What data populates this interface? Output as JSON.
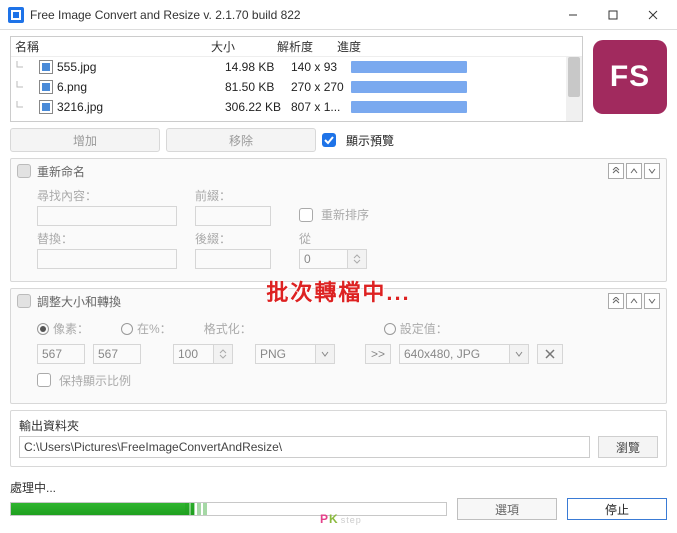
{
  "window": {
    "title": "Free Image Convert and Resize  v. 2.1.70 build 822"
  },
  "logo_text": "FS",
  "table": {
    "headers": {
      "name": "名稱",
      "size": "大小",
      "resolution": "解析度",
      "progress": "進度"
    },
    "rows": [
      {
        "name": "555.jpg",
        "size": "14.98 KB",
        "resolution": "140 x 93"
      },
      {
        "name": "6.png",
        "size": "81.50 KB",
        "resolution": "270 x 270"
      },
      {
        "name": "3216.jpg",
        "size": "306.22 KB",
        "resolution": "807 x 1..."
      }
    ]
  },
  "toolbar": {
    "add": "增加",
    "remove": "移除",
    "preview": "顯示預覽"
  },
  "rename": {
    "title": "重新命名",
    "find_label": "尋找內容：",
    "replace_label": "替換：",
    "prefix_label": "前綴：",
    "suffix_label": "後綴：",
    "reorder_label": "重新排序",
    "from_label": "從",
    "from_value": "0"
  },
  "resize": {
    "title": "調整大小和轉換",
    "pixels_label": "像素：",
    "percent_label": "在%：",
    "format_label": "格式化：",
    "preset_label": "設定值：",
    "w": "567",
    "h": "567",
    "pct": "100",
    "format": "PNG",
    "preset": "640x480, JPG",
    "arrow": ">>",
    "keep_ratio": "保持顯示比例"
  },
  "overlay": "批次轉檔中...",
  "output": {
    "title": "輸出資料夾",
    "path": "C:\\Users\\Pictures\\FreeImageConvertAndResize\\",
    "browse": "瀏覽"
  },
  "footer": {
    "status": "處理中...",
    "options": "選項",
    "stop": "停止"
  },
  "watermark": {
    "p": "P",
    "k": "K",
    "suffix": "step"
  }
}
